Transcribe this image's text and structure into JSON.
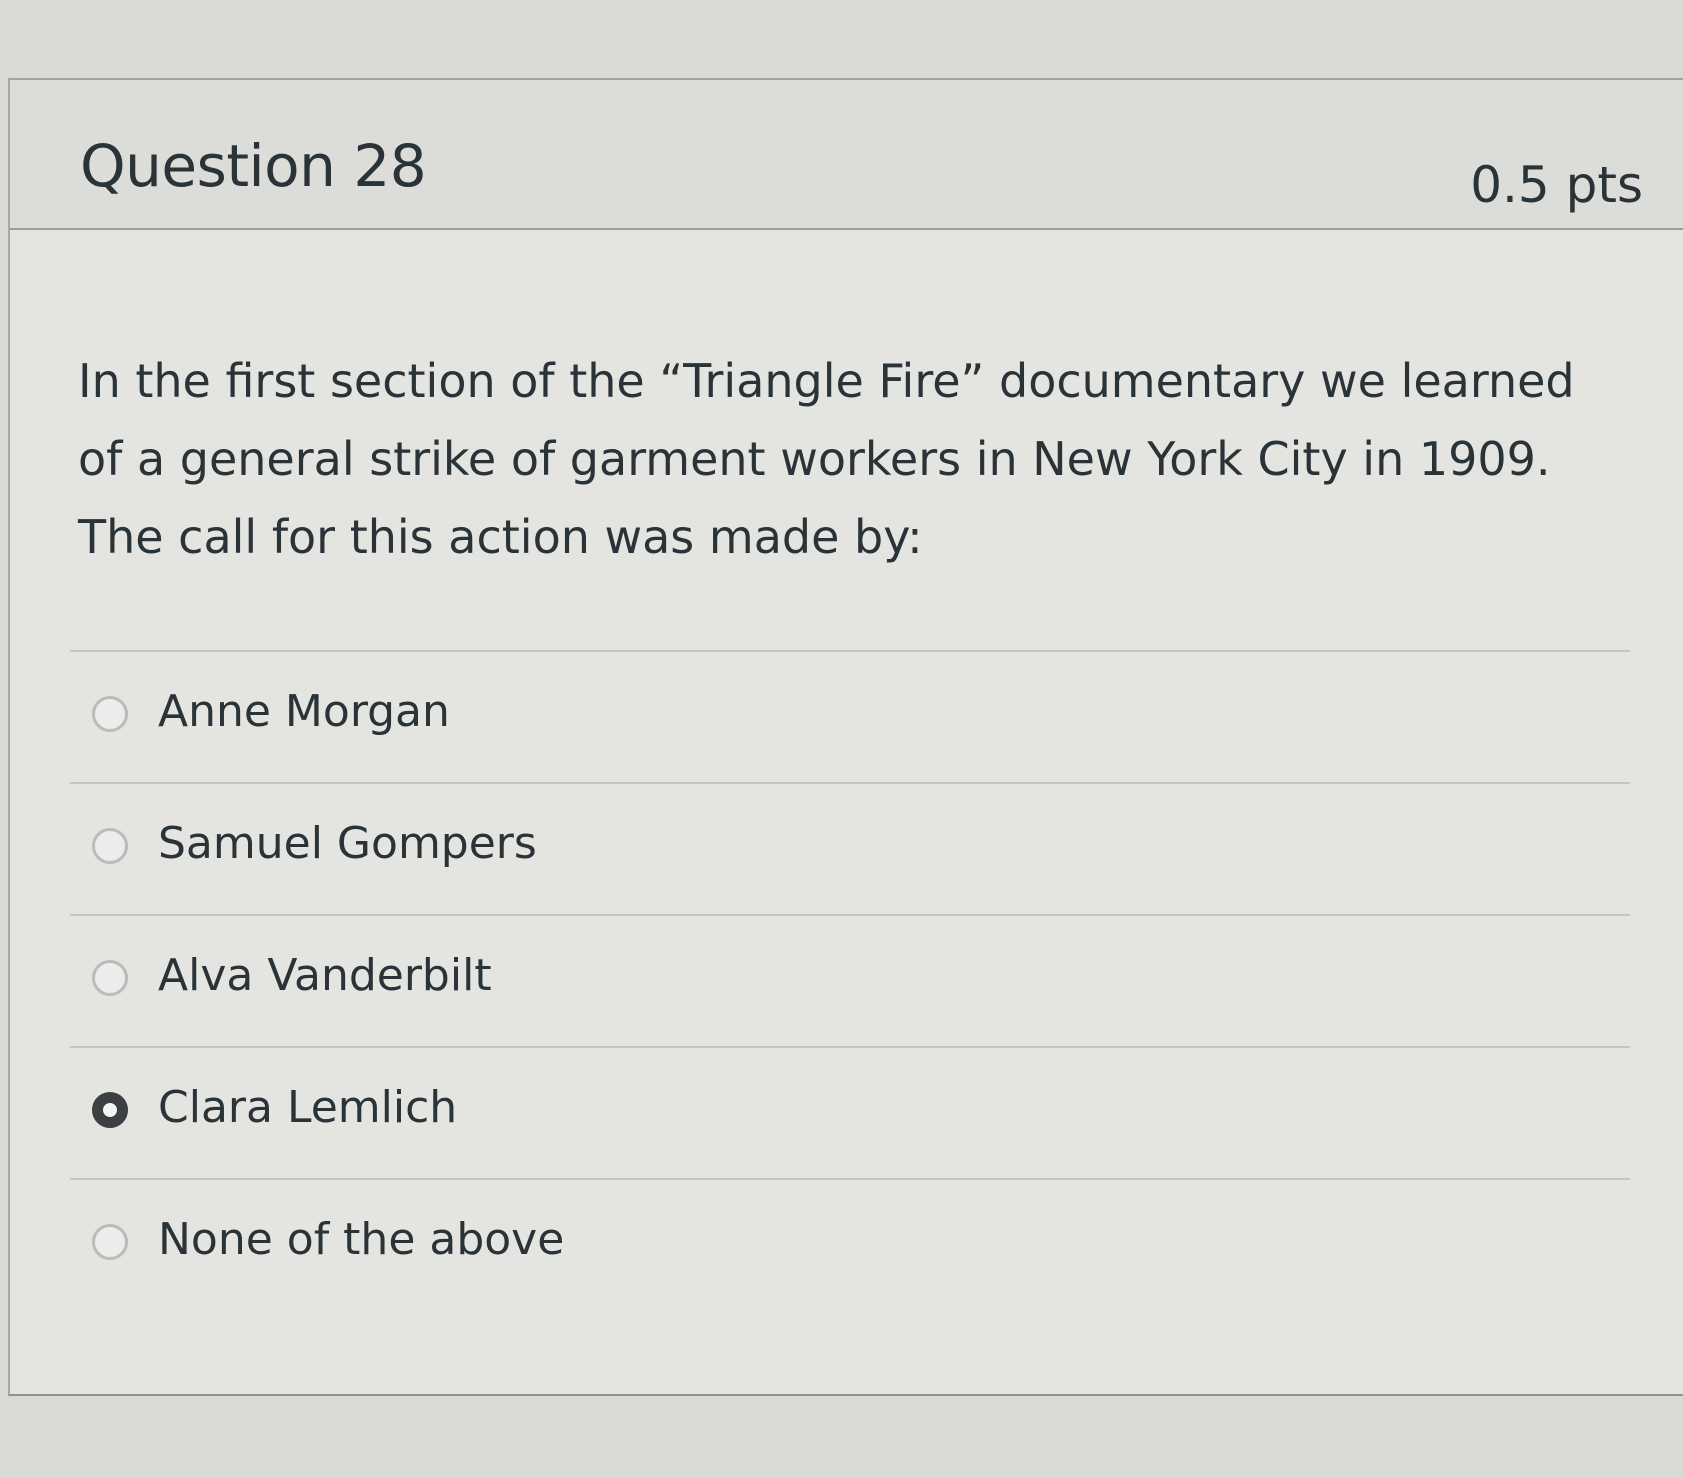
{
  "question": {
    "title": "Question 28",
    "points": "0.5 pts",
    "text": "In the first section of the “Triangle Fire” documentary we learned of a general strike of garment workers in New York City in 1909. The call for this action was made by:"
  },
  "answers": [
    {
      "label": "Anne Morgan",
      "selected": false
    },
    {
      "label": "Samuel Gompers",
      "selected": false
    },
    {
      "label": "Alva Vanderbilt",
      "selected": false
    },
    {
      "label": "Clara Lemlich",
      "selected": true
    },
    {
      "label": "None of the above",
      "selected": false
    }
  ]
}
